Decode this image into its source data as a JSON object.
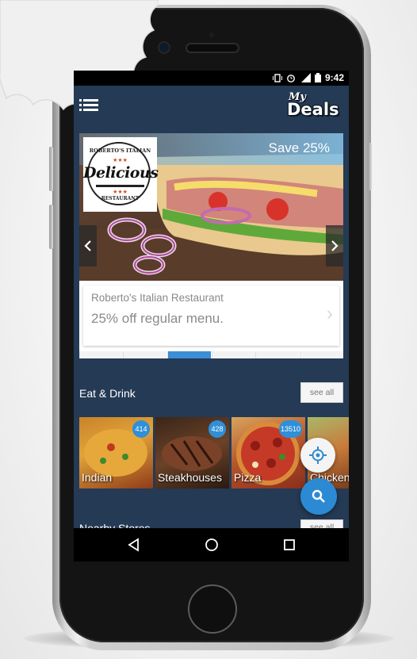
{
  "status_bar": {
    "time": "9:42"
  },
  "app": {
    "logo_my": "My",
    "logo_deals": "Deals"
  },
  "featured_deal": {
    "save_label": "Save 25%",
    "restaurant_name": "Roberto's Italian Restaurant",
    "offer": "25% off regular menu.",
    "logo": {
      "top": "ROBERTO'S ITALIAN",
      "script": "Delicious",
      "bottom": "RESTAURANT"
    }
  },
  "eat_drink": {
    "title": "Eat & Drink",
    "see_all": "see all",
    "categories": [
      {
        "label": "Indian",
        "count": "414"
      },
      {
        "label": "Steakhouses",
        "count": "428"
      },
      {
        "label": "Pizza",
        "count": "13510"
      },
      {
        "label": "Chicken",
        "count": ""
      }
    ]
  },
  "nearby_stores": {
    "title": "Nearby Stores",
    "see_all": "see all"
  },
  "colors": {
    "screen_bg": "#243a55",
    "accent_blue": "#2b8ad3",
    "save_band": "#80bee6"
  }
}
